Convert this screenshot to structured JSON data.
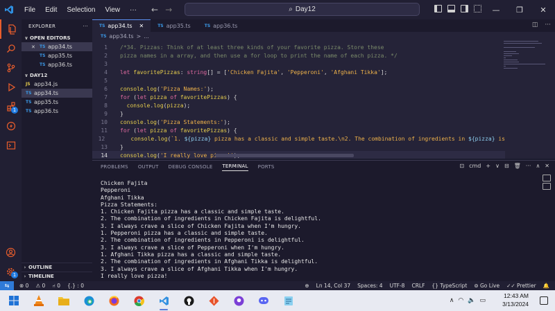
{
  "titlebar": {
    "menu": [
      "File",
      "Edit",
      "Selection",
      "View",
      "···"
    ],
    "search_text": "Day12"
  },
  "sidebar": {
    "title": "EXPLORER",
    "more": "···",
    "open_editors_label": "OPEN EDITORS",
    "open_editors": [
      {
        "name": "app34.ts",
        "type": "TS",
        "close": "✕"
      },
      {
        "name": "app35.ts",
        "type": "TS"
      },
      {
        "name": "app36.ts",
        "type": "TS"
      }
    ],
    "folder_label": "DAY12",
    "files": [
      {
        "name": "app34.js",
        "type": "JS"
      },
      {
        "name": "app34.ts",
        "type": "TS"
      },
      {
        "name": "app35.ts",
        "type": "TS"
      },
      {
        "name": "app36.ts",
        "type": "TS"
      }
    ],
    "outline_label": "OUTLINE",
    "timeline_label": "TIMELINE",
    "badge_count": "1"
  },
  "tabs": [
    {
      "name": "app34.ts",
      "type": "TS",
      "close": "✕"
    },
    {
      "name": "app35.ts",
      "type": "TS"
    },
    {
      "name": "app36.ts",
      "type": "TS"
    }
  ],
  "breadcrumb": {
    "type": "TS",
    "file": "app34.ts",
    "sep": ">",
    "rest": "..."
  },
  "editor": {
    "lines": [
      {
        "n": "1",
        "parts": [
          {
            "c": "c-cmt",
            "t": "/*34. Pizzas: Think of at least three kinds of your favorite pizza. Store these"
          }
        ]
      },
      {
        "n": "2",
        "parts": [
          {
            "c": "c-cmt",
            "t": "pizza names in a array, and then use a for loop to print the name of each pizza. */"
          }
        ]
      },
      {
        "n": "3",
        "parts": []
      },
      {
        "n": "4",
        "parts": [
          {
            "c": "c-kw",
            "t": "let "
          },
          {
            "c": "c-var",
            "t": "favoritePizzas"
          },
          {
            "c": "c-pl",
            "t": ": "
          },
          {
            "c": "c-type",
            "t": "string"
          },
          {
            "c": "c-pl",
            "t": "[] = ["
          },
          {
            "c": "c-str",
            "t": "'Chicken Fajita'"
          },
          {
            "c": "c-pl",
            "t": ", "
          },
          {
            "c": "c-str",
            "t": "'Pepperoni'"
          },
          {
            "c": "c-pl",
            "t": ", "
          },
          {
            "c": "c-str",
            "t": "'Afghani Tikka'"
          },
          {
            "c": "c-pl",
            "t": "];"
          }
        ]
      },
      {
        "n": "5",
        "parts": []
      },
      {
        "n": "6",
        "parts": [
          {
            "c": "c-fn",
            "t": "console"
          },
          {
            "c": "c-pl",
            "t": "."
          },
          {
            "c": "c-fn",
            "t": "log"
          },
          {
            "c": "c-pl",
            "t": "("
          },
          {
            "c": "c-str",
            "t": "'Pizza Names:'"
          },
          {
            "c": "c-pl",
            "t": ");"
          }
        ]
      },
      {
        "n": "7",
        "parts": [
          {
            "c": "c-kw",
            "t": "for "
          },
          {
            "c": "c-pl",
            "t": "("
          },
          {
            "c": "c-kw",
            "t": "let "
          },
          {
            "c": "c-var",
            "t": "pizza "
          },
          {
            "c": "c-kw",
            "t": "of "
          },
          {
            "c": "c-var",
            "t": "favoritePizzas"
          },
          {
            "c": "c-pl",
            "t": ") {"
          }
        ]
      },
      {
        "n": "8",
        "parts": [
          {
            "c": "c-pl",
            "t": "  "
          },
          {
            "c": "c-fn",
            "t": "console"
          },
          {
            "c": "c-pl",
            "t": "."
          },
          {
            "c": "c-fn",
            "t": "log"
          },
          {
            "c": "c-pl",
            "t": "("
          },
          {
            "c": "c-var",
            "t": "pizza"
          },
          {
            "c": "c-pl",
            "t": ");"
          }
        ]
      },
      {
        "n": "9",
        "parts": [
          {
            "c": "c-pl",
            "t": "}"
          }
        ]
      },
      {
        "n": "10",
        "parts": [
          {
            "c": "c-fn",
            "t": "console"
          },
          {
            "c": "c-pl",
            "t": "."
          },
          {
            "c": "c-fn",
            "t": "log"
          },
          {
            "c": "c-pl",
            "t": "("
          },
          {
            "c": "c-str",
            "t": "'Pizza Statements:'"
          },
          {
            "c": "c-pl",
            "t": ");"
          }
        ]
      },
      {
        "n": "11",
        "parts": [
          {
            "c": "c-kw",
            "t": "for "
          },
          {
            "c": "c-pl",
            "t": "("
          },
          {
            "c": "c-kw",
            "t": "let "
          },
          {
            "c": "c-var",
            "t": "pizza "
          },
          {
            "c": "c-kw",
            "t": "of "
          },
          {
            "c": "c-var",
            "t": "favoritePizzas"
          },
          {
            "c": "c-pl",
            "t": ") {"
          }
        ]
      },
      {
        "n": "12",
        "parts": [
          {
            "c": "c-pl",
            "t": "    "
          },
          {
            "c": "c-fn",
            "t": "console"
          },
          {
            "c": "c-pl",
            "t": "."
          },
          {
            "c": "c-fn",
            "t": "log"
          },
          {
            "c": "c-pl",
            "t": "("
          },
          {
            "c": "c-str",
            "t": "`1. "
          },
          {
            "c": "c-tmp",
            "t": "${pizza}"
          },
          {
            "c": "c-str",
            "t": " pizza has a classic and simple taste.\\n2. The combination of ingredients in "
          },
          {
            "c": "c-tmp",
            "t": "${pizza}"
          },
          {
            "c": "c-str",
            "t": " is"
          }
        ]
      },
      {
        "n": "13",
        "parts": [
          {
            "c": "c-pl",
            "t": "}"
          }
        ]
      },
      {
        "n": "14",
        "parts": [
          {
            "c": "c-fn",
            "t": "console"
          },
          {
            "c": "c-pl",
            "t": "."
          },
          {
            "c": "c-fn",
            "t": "log"
          },
          {
            "c": "c-pl",
            "t": "("
          },
          {
            "c": "c-str",
            "t": "'I really love pizza!'"
          },
          {
            "c": "c-pl",
            "t": ");"
          }
        ]
      }
    ],
    "current_line": "14"
  },
  "panel": {
    "tabs": [
      "PROBLEMS",
      "OUTPUT",
      "DEBUG CONSOLE",
      "TERMINAL",
      "PORTS"
    ],
    "active_tab": "TERMINAL",
    "shell": "cmd",
    "tools": [
      "+",
      "∨",
      "⊟",
      "🗑",
      "···",
      "∧",
      "✕"
    ],
    "terminal_lines": [
      "Chicken Fajita",
      "Pepperoni",
      "Afghani Tikka",
      "Pizza Statements:",
      "1. Chicken Fajita pizza has a classic and simple taste.",
      "2. The combination of ingredients in Chicken Fajita is delightful.",
      "3. I always crave a slice of Chicken Fajita when I'm hungry.",
      "1. Pepperoni pizza has a classic and simple taste.",
      "2. The combination of ingredients in Pepperoni is delightful.",
      "3. I always crave a slice of Pepperoni when I'm hungry.",
      "1. Afghani Tikka pizza has a classic and simple taste.",
      "2. The combination of ingredients in Afghani Tikka is delightful.",
      "3. I always crave a slice of Afghani Tikka when I'm hungry.",
      "I really love pizza!"
    ]
  },
  "statusbar": {
    "remote": "⇆",
    "errors": "⊗ 0",
    "warnings": "⚠ 0",
    "ports": "⑁ 0",
    "info": "{.} : 0",
    "cursor": "Ln 14, Col 37",
    "spaces": "Spaces: 4",
    "encoding": "UTF-8",
    "eol": "CRLF",
    "language": "{} TypeScript",
    "golive": "⊚ Go Live",
    "prettier": "✓✓ Prettier"
  },
  "taskbar": {
    "time": "12:43 AM",
    "date": "3/13/2024"
  },
  "colors": {
    "accent": "#2f7ad8",
    "ts": "#3b9ae8",
    "js": "#e6cd4c",
    "active_activity": "#e85d2c"
  }
}
